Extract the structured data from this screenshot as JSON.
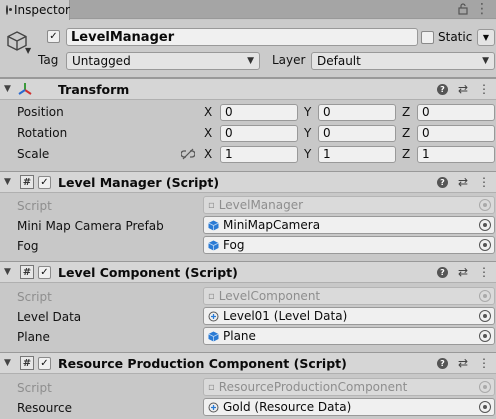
{
  "tab": {
    "label": "Inspector"
  },
  "object": {
    "name": "LevelManager",
    "active": true,
    "static_label": "Static",
    "tag_label": "Tag",
    "tag_value": "Untagged",
    "layer_label": "Layer",
    "layer_value": "Default"
  },
  "transform": {
    "title": "Transform",
    "rows": [
      {
        "label": "Position",
        "x": "0",
        "y": "0",
        "z": "0"
      },
      {
        "label": "Rotation",
        "x": "0",
        "y": "0",
        "z": "0"
      },
      {
        "label": "Scale",
        "x": "1",
        "y": "1",
        "z": "1"
      }
    ],
    "axes": {
      "x": "X",
      "y": "Y",
      "z": "Z"
    }
  },
  "level_manager": {
    "title": "Level Manager (Script)",
    "script_label": "Script",
    "script_value": "LevelManager",
    "field1_label": "Mini Map Camera Prefab",
    "field1_value": "MiniMapCamera",
    "field2_label": "Fog",
    "field2_value": "Fog"
  },
  "level_component": {
    "title": "Level Component (Script)",
    "script_label": "Script",
    "script_value": "LevelComponent",
    "field1_label": "Level Data",
    "field1_value": "Level01 (Level Data)",
    "field2_label": "Plane",
    "field2_value": "Plane"
  },
  "resource_component": {
    "title": "Resource Production Component (Script)",
    "script_label": "Script",
    "script_value": "ResourceProductionComponent",
    "field1_label": "Resource",
    "field1_value": "Gold (Resource Data)"
  },
  "colors": {
    "panel_bg": "#c8c8c8",
    "header_bg": "#d6d6d6",
    "field_bg": "#f0f0f0",
    "prefab_blue": "#2a7ad4"
  }
}
